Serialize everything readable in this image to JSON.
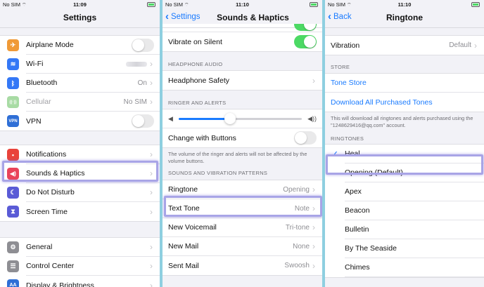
{
  "p1": {
    "status": {
      "carrier": "No SIM",
      "time": "11:09"
    },
    "title": "Settings",
    "group1": [
      {
        "label": "Airplane Mode",
        "icon": "airplane-icon",
        "color": "#f09a37",
        "glyph": "✈"
      },
      {
        "label": "Wi-Fi",
        "icon": "wifi-icon",
        "color": "#3478f6",
        "glyph": "≋"
      },
      {
        "label": "Bluetooth",
        "icon": "bluetooth-icon",
        "color": "#3478f6",
        "glyph": "ᛒ",
        "value": "On"
      },
      {
        "label": "Cellular",
        "icon": "cellular-icon",
        "color": "#8fd48a",
        "glyph": "((·))",
        "value": "No SIM"
      },
      {
        "label": "VPN",
        "icon": "vpn-icon",
        "color": "#2f6fd6",
        "glyph": "VPN"
      }
    ],
    "group2": [
      {
        "label": "Notifications",
        "icon": "notifications-icon",
        "color": "#e9433b",
        "glyph": "▪"
      },
      {
        "label": "Sounds & Haptics",
        "icon": "sounds-icon",
        "color": "#e9435a",
        "glyph": "🔊"
      },
      {
        "label": "Do Not Disturb",
        "icon": "moon-icon",
        "color": "#5a5bd6",
        "glyph": "☾"
      },
      {
        "label": "Screen Time",
        "icon": "hourglass-icon",
        "color": "#5a5bd6",
        "glyph": "⧗"
      }
    ],
    "group3": [
      {
        "label": "General",
        "icon": "gear-icon",
        "color": "#8e8e93",
        "glyph": "⚙"
      },
      {
        "label": "Control Center",
        "icon": "control-center-icon",
        "color": "#8e8e93",
        "glyph": "☰"
      },
      {
        "label": "Display & Brightness",
        "icon": "display-icon",
        "color": "#2f6fd6",
        "glyph": "AA"
      }
    ]
  },
  "p2": {
    "status": {
      "carrier": "No SIM",
      "time": "11:10"
    },
    "back": "Settings",
    "title": "Sounds & Haptics",
    "vibrate_silent": "Vibrate on Silent",
    "headphone_header": "HEADPHONE AUDIO",
    "headphone_safety": "Headphone Safety",
    "ringer_header": "RINGER AND ALERTS",
    "ringer_level": 0.42,
    "change_buttons": "Change with Buttons",
    "ringer_note": "The volume of the ringer and alerts will not be affected by the volume buttons.",
    "patterns_header": "SOUNDS AND VIBRATION PATTERNS",
    "patterns": [
      {
        "label": "Ringtone",
        "value": "Opening"
      },
      {
        "label": "Text Tone",
        "value": "Note"
      },
      {
        "label": "New Voicemail",
        "value": "Tri-tone"
      },
      {
        "label": "New Mail",
        "value": "None"
      },
      {
        "label": "Sent Mail",
        "value": "Swoosh"
      }
    ]
  },
  "p3": {
    "status": {
      "carrier": "No SIM",
      "time": "11:10"
    },
    "back": "Back",
    "title": "Ringtone",
    "vibration": "Vibration",
    "vibration_value": "Default",
    "store_header": "STORE",
    "tone_store": "Tone Store",
    "download_all": "Download All Purchased Tones",
    "store_note": "This will download all ringtones and alerts purchased using the \"1248629416@qq.com\" account.",
    "ringtones_header": "RINGTONES",
    "tones": [
      "Heal",
      "Opening (Default)",
      "Apex",
      "Beacon",
      "Bulletin",
      "By The Seaside",
      "Chimes"
    ]
  }
}
